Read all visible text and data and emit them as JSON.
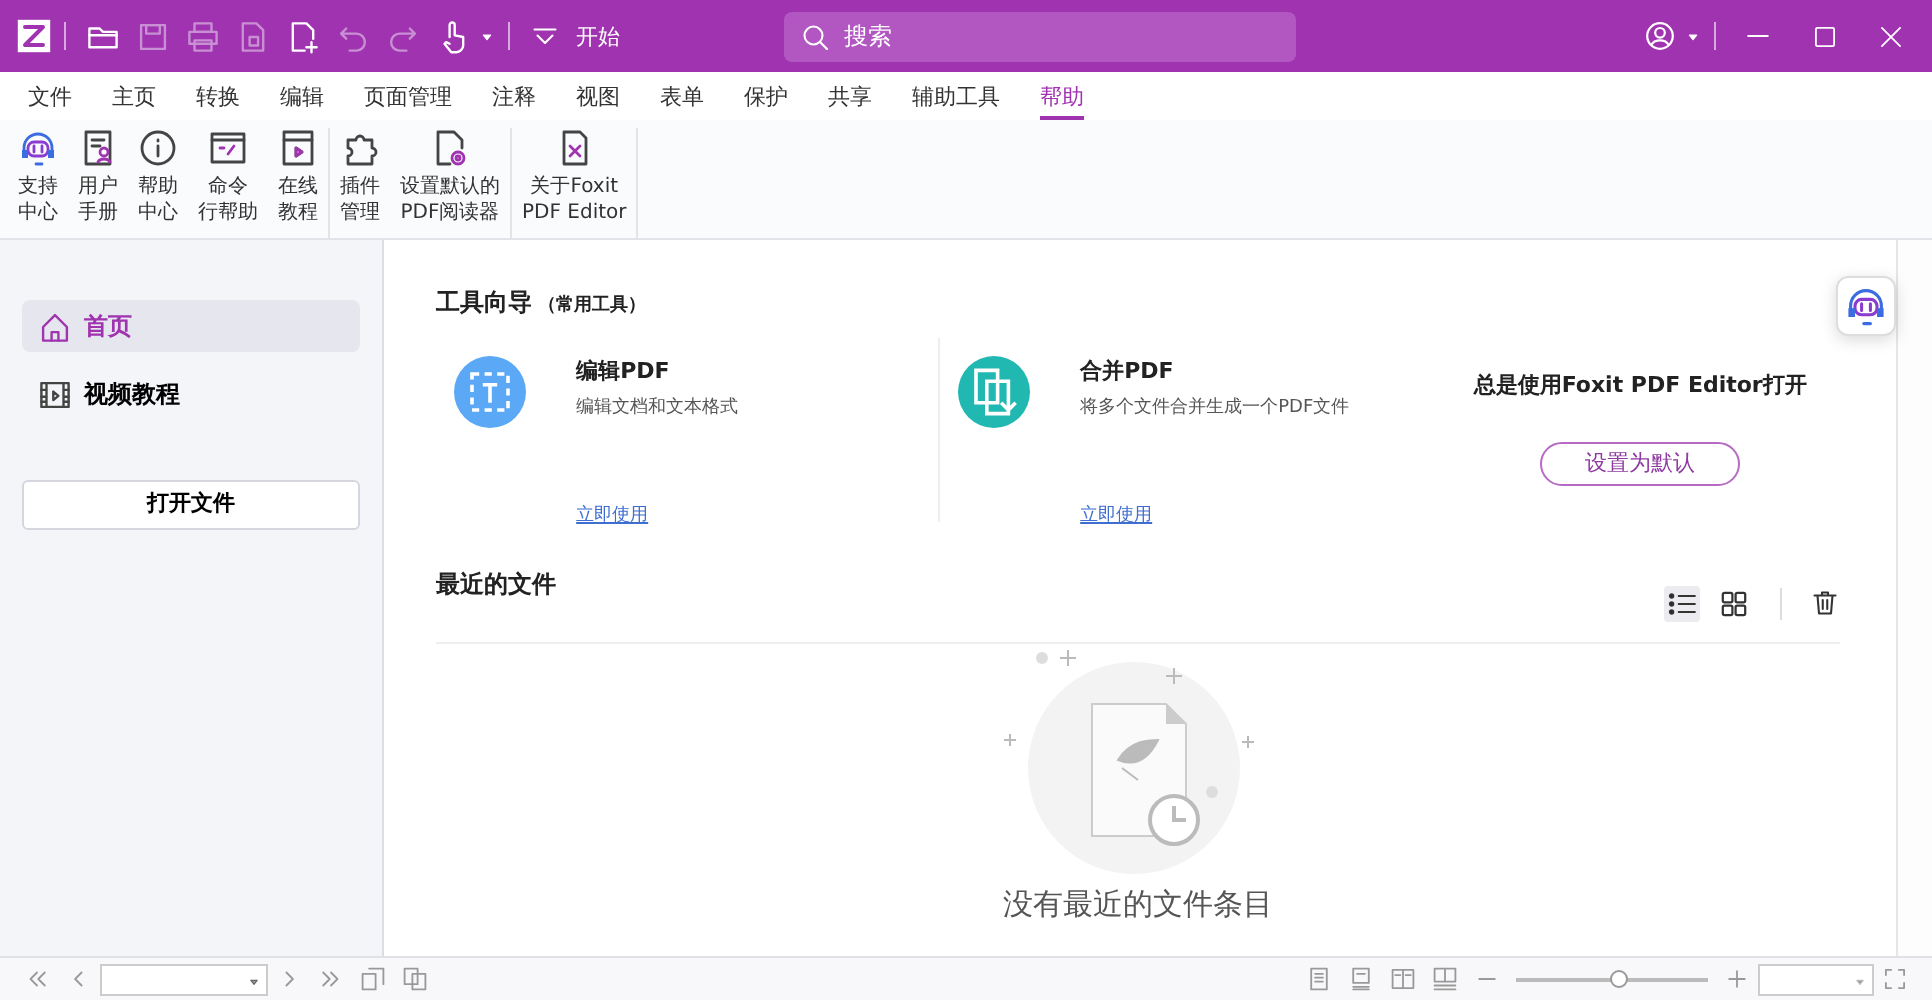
{
  "window": {
    "quick_toolbar_label": "开始",
    "search": {
      "placeholder": "搜索"
    }
  },
  "menu_tabs": [
    {
      "label": "文件",
      "selected": false
    },
    {
      "label": "主页",
      "selected": false
    },
    {
      "label": "转换",
      "selected": false
    },
    {
      "label": "编辑",
      "selected": false
    },
    {
      "label": "页面管理",
      "selected": false
    },
    {
      "label": "注释",
      "selected": false
    },
    {
      "label": "视图",
      "selected": false
    },
    {
      "label": "表单",
      "selected": false
    },
    {
      "label": "保护",
      "selected": false
    },
    {
      "label": "共享",
      "selected": false
    },
    {
      "label": "辅助工具",
      "selected": false
    },
    {
      "label": "帮助",
      "selected": true
    }
  ],
  "ribbon": {
    "groups": [
      [
        {
          "lines": [
            "支持",
            "中心"
          ]
        },
        {
          "lines": [
            "用户",
            "手册"
          ]
        },
        {
          "lines": [
            "帮助",
            "中心"
          ]
        },
        {
          "lines": [
            "命令",
            "行帮助"
          ]
        },
        {
          "lines": [
            "在线",
            "教程"
          ]
        }
      ],
      [
        {
          "lines": [
            "插件",
            "管理"
          ]
        },
        {
          "lines": [
            "设置默认的",
            "PDF阅读器"
          ]
        }
      ],
      [
        {
          "lines": [
            "关于Foxit",
            "PDF Editor"
          ]
        }
      ]
    ]
  },
  "sidebar": {
    "items": [
      {
        "label": "首页",
        "selected": true
      },
      {
        "label": "视频教程",
        "selected": false
      }
    ],
    "open_button": "打开文件"
  },
  "tool_guide": {
    "title": "工具向导",
    "subtitle": "（常用工具）",
    "tools": [
      {
        "name": "编辑PDF",
        "description": "编辑文档和文本格式",
        "link": "立即使用",
        "color": "#5aa8f6"
      },
      {
        "name": "合并PDF",
        "description": "将多个文件合并生成一个PDF文件",
        "link": "立即使用",
        "color": "#22b8b2"
      }
    ],
    "default_prompt": "总是使用Foxit PDF Editor打开",
    "default_button": "设置为默认"
  },
  "recent": {
    "title": "最近的文件",
    "views": [
      {
        "kind": "list",
        "selected": true
      },
      {
        "kind": "grid",
        "selected": false
      }
    ],
    "empty_message": "没有最近的文件条目"
  },
  "status_bar": {
    "zoom": {
      "level": 0.53
    }
  }
}
